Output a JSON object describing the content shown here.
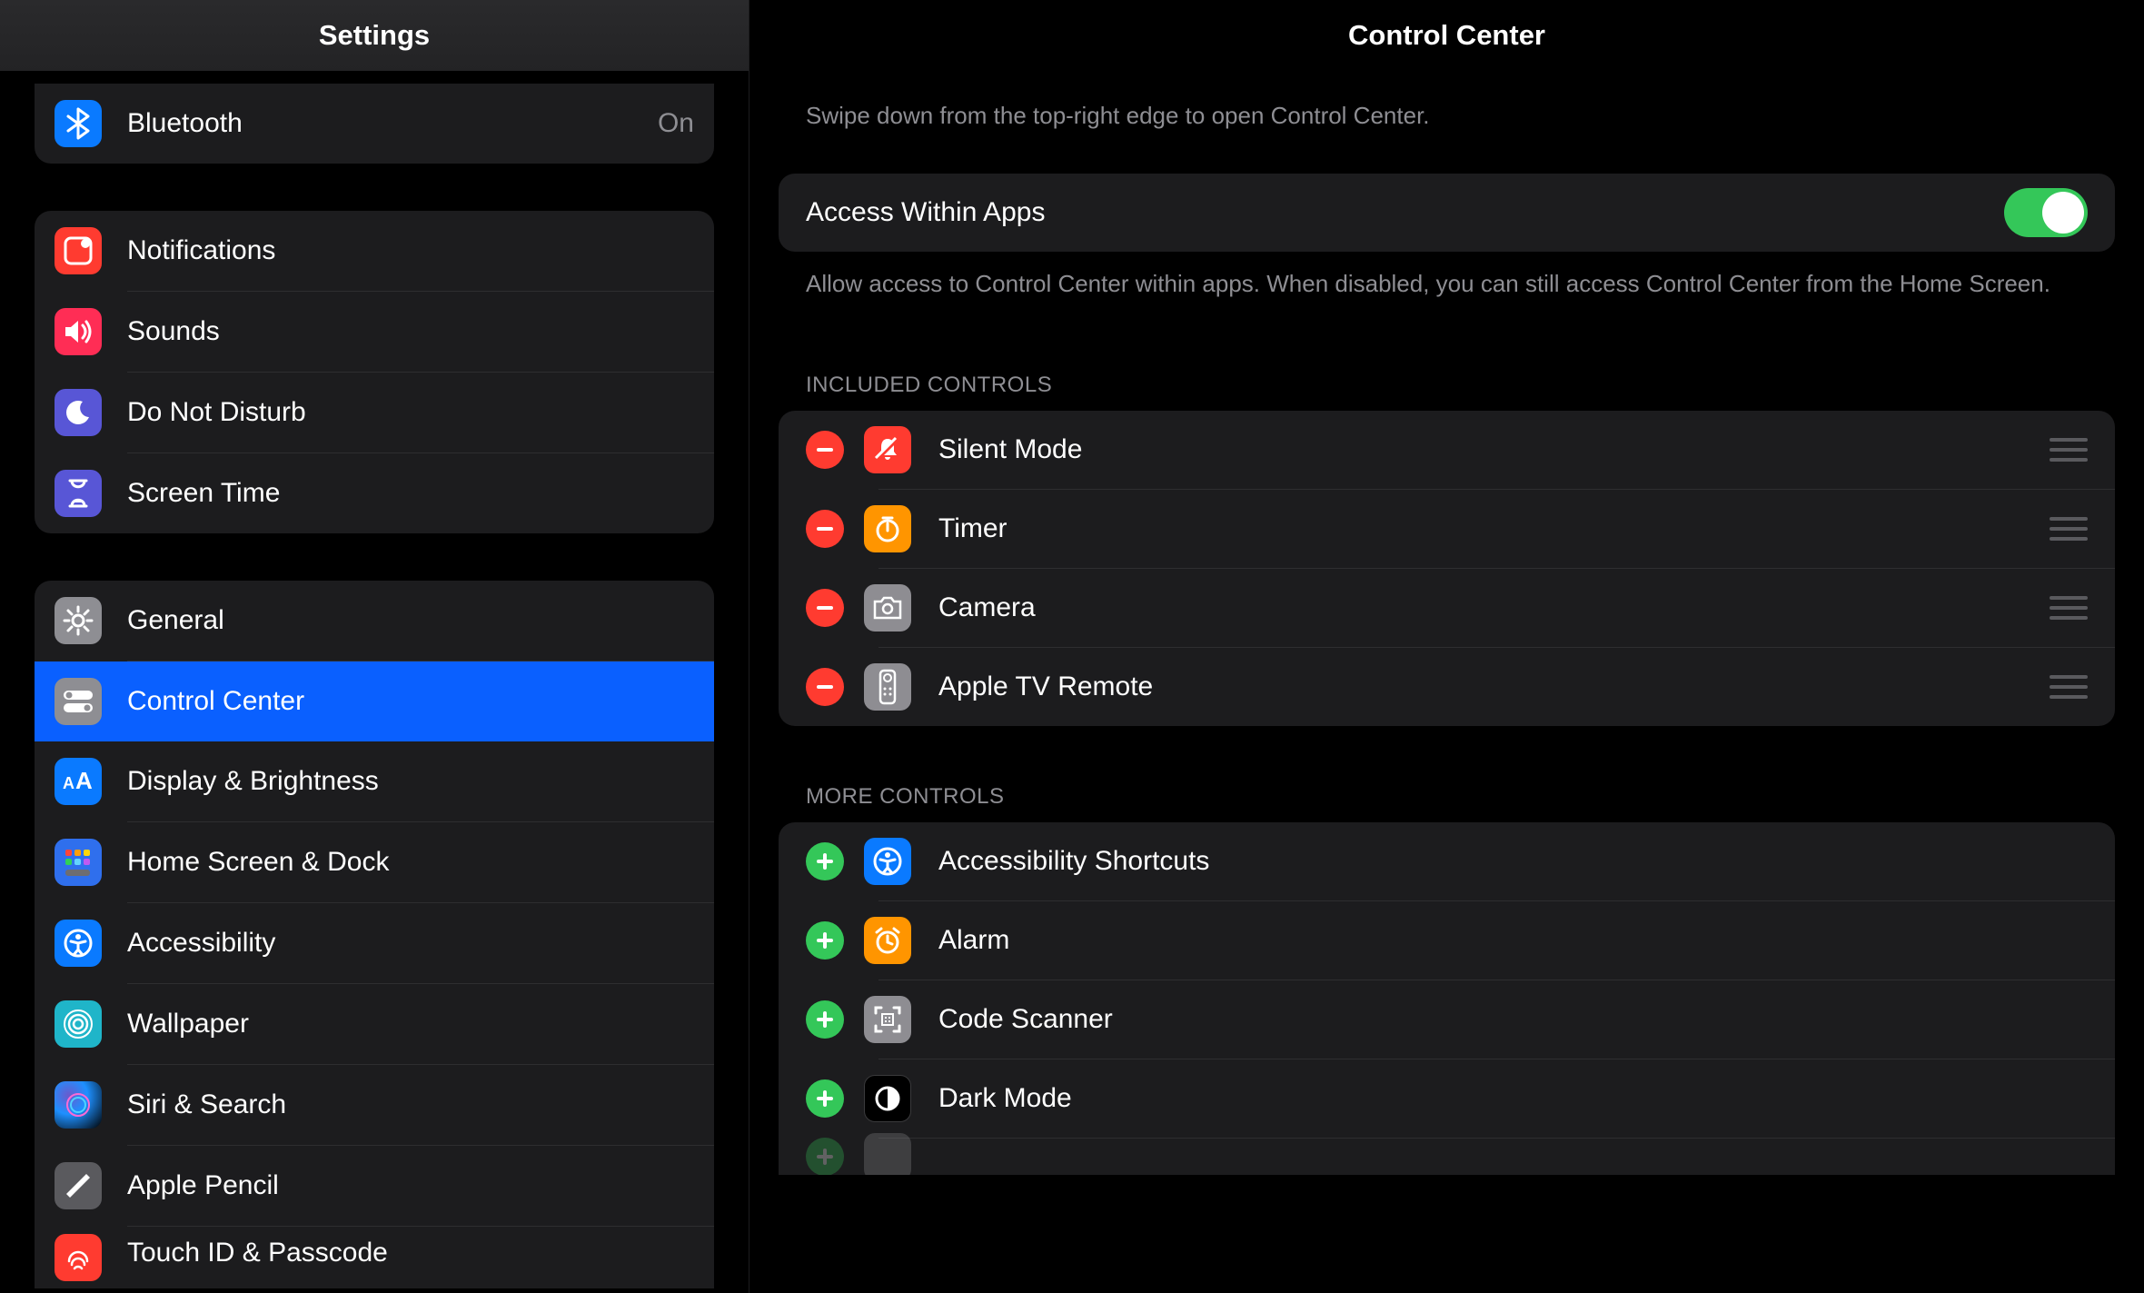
{
  "sidebar": {
    "title": "Settings",
    "group0": [
      {
        "label": "Bluetooth",
        "value": "On"
      }
    ],
    "group1": [
      {
        "label": "Notifications"
      },
      {
        "label": "Sounds"
      },
      {
        "label": "Do Not Disturb"
      },
      {
        "label": "Screen Time"
      }
    ],
    "group2": [
      {
        "label": "General"
      },
      {
        "label": "Control Center"
      },
      {
        "label": "Display & Brightness"
      },
      {
        "label": "Home Screen & Dock"
      },
      {
        "label": "Accessibility"
      },
      {
        "label": "Wallpaper"
      },
      {
        "label": "Siri & Search"
      },
      {
        "label": "Apple Pencil"
      },
      {
        "label": "Touch ID & Passcode"
      }
    ]
  },
  "detail": {
    "title": "Control Center",
    "hint": "Swipe down from the top-right edge to open Control Center.",
    "access_label": "Access Within Apps",
    "access_footer": "Allow access to Control Center within apps. When disabled, you can still access Control Center from the Home Screen.",
    "included_header": "INCLUDED CONTROLS",
    "included": [
      {
        "label": "Silent Mode"
      },
      {
        "label": "Timer"
      },
      {
        "label": "Camera"
      },
      {
        "label": "Apple TV Remote"
      }
    ],
    "more_header": "MORE CONTROLS",
    "more": [
      {
        "label": "Accessibility Shortcuts"
      },
      {
        "label": "Alarm"
      },
      {
        "label": "Code Scanner"
      },
      {
        "label": "Dark Mode"
      }
    ]
  }
}
